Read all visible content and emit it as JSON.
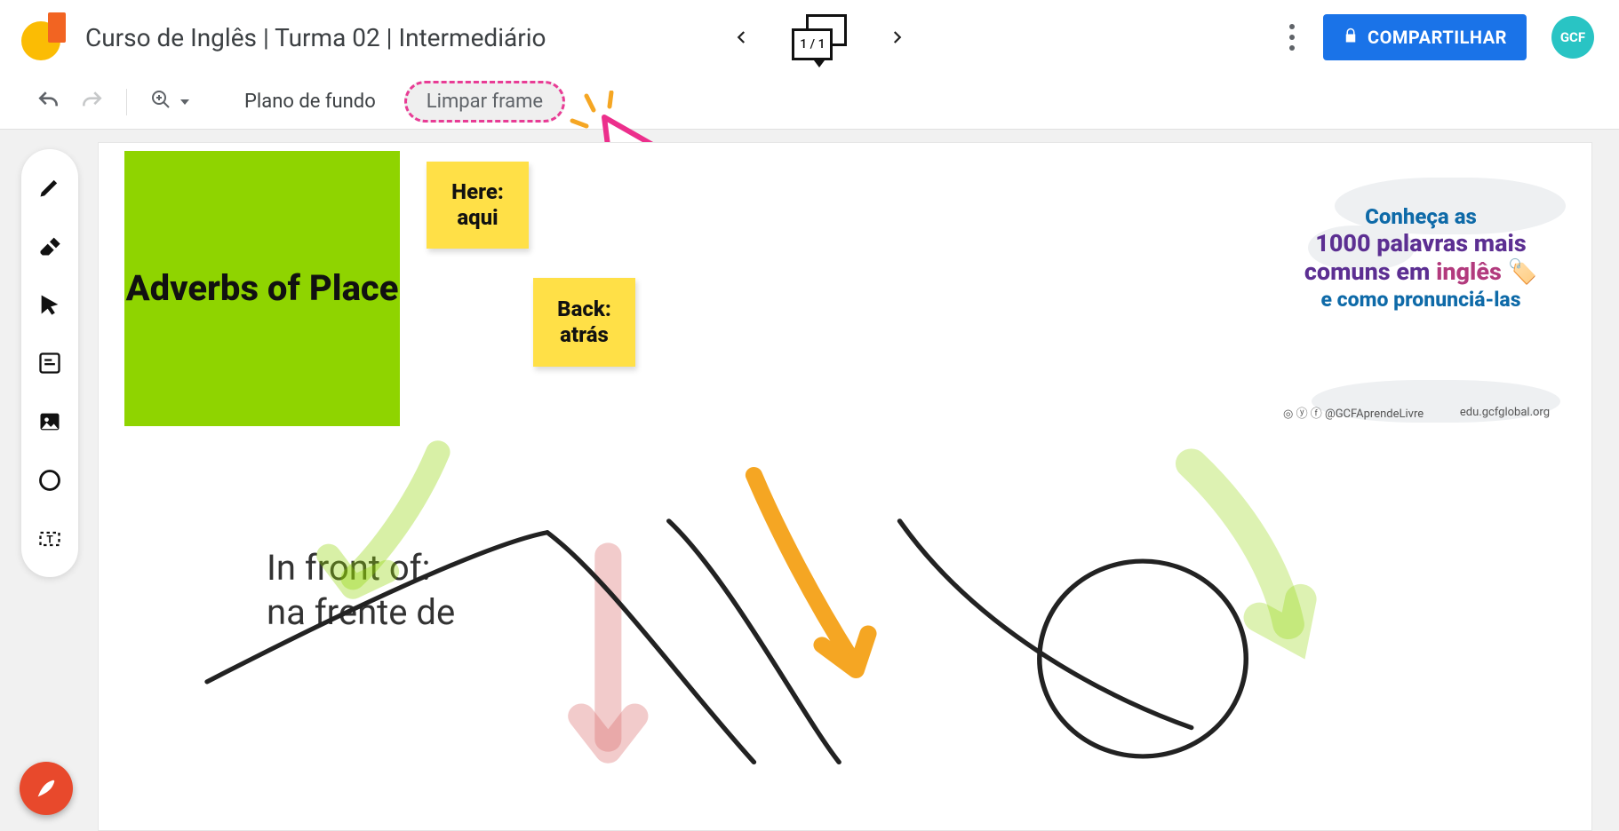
{
  "header": {
    "title": "Curso de Inglês | Turma 02 | Intermediário",
    "frame_indicator": "1 / 1",
    "share_label": "COMPARTILHAR",
    "avatar_text": "GCF"
  },
  "toolbar": {
    "background_label": "Plano de fundo",
    "clear_frame_label": "Limpar frame"
  },
  "canvas": {
    "green_card": "Adverbs of Place",
    "sticky_here": "Here:\naqui",
    "sticky_back": "Back:\natrás",
    "infront_text": "In front of:\nna frente de",
    "poster": {
      "line1": "Conheça as",
      "line2": "1000 palavras mais",
      "line3_a": "comuns em",
      "line3_b": "inglês",
      "line4": "e como pronunciá-las",
      "handle": "@GCFAprendeLivre",
      "url": "edu.gcfglobal.org"
    }
  }
}
